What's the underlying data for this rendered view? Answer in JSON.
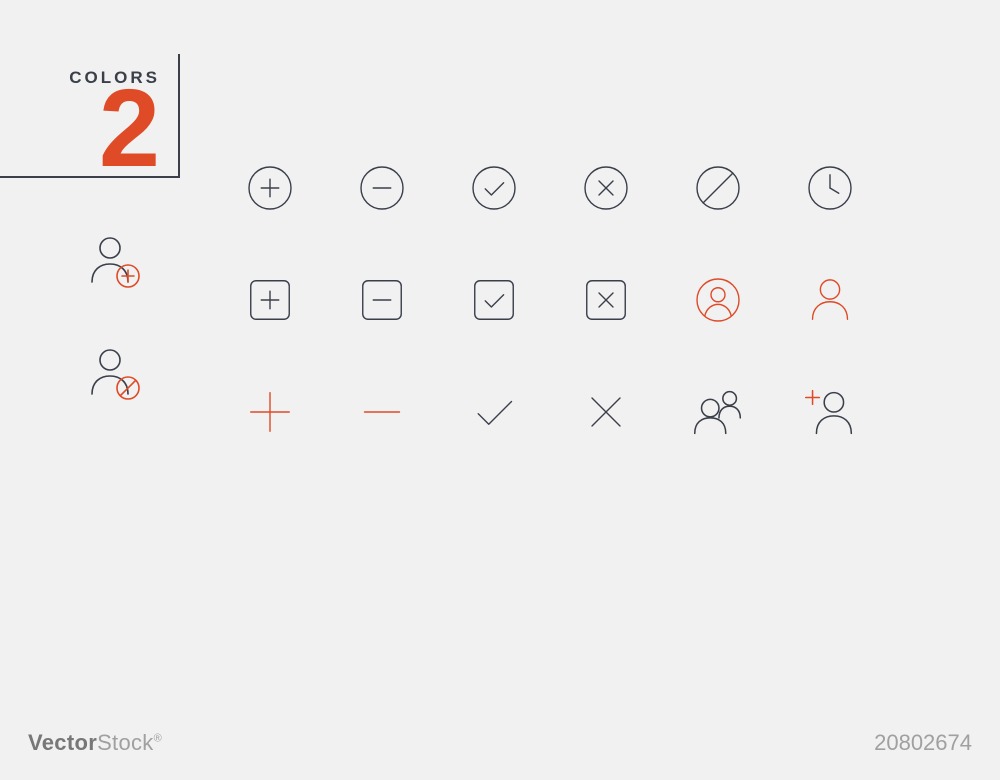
{
  "badge": {
    "label": "COLORS",
    "count": "2"
  },
  "colors": {
    "dark": "#3a3f4a",
    "accent": "#df4a27"
  },
  "icons": {
    "row1": [
      {
        "name": "circle-plus",
        "color": "dark"
      },
      {
        "name": "circle-minus",
        "color": "dark"
      },
      {
        "name": "circle-check",
        "color": "dark"
      },
      {
        "name": "circle-x",
        "color": "dark"
      },
      {
        "name": "circle-slash",
        "color": "dark"
      },
      {
        "name": "clock",
        "color": "dark"
      }
    ],
    "row2": [
      {
        "name": "square-plus",
        "color": "dark"
      },
      {
        "name": "square-minus",
        "color": "dark"
      },
      {
        "name": "square-check",
        "color": "dark"
      },
      {
        "name": "square-x",
        "color": "dark"
      },
      {
        "name": "user-circle",
        "color": "accent"
      },
      {
        "name": "user",
        "color": "accent"
      }
    ],
    "row3": [
      {
        "name": "plus-plain",
        "color": "accent"
      },
      {
        "name": "minus-plain",
        "color": "accent"
      },
      {
        "name": "check-plain",
        "color": "dark"
      },
      {
        "name": "x-plain",
        "color": "dark"
      },
      {
        "name": "users-group",
        "color": "dark"
      },
      {
        "name": "user-add",
        "color": "dark"
      }
    ],
    "leftcol": [
      {
        "name": "user-plus-circle",
        "color": "dark",
        "sub": "accent"
      },
      {
        "name": "user-block",
        "color": "dark",
        "sub": "accent"
      }
    ]
  },
  "footer": {
    "brand_prefix": "Vector",
    "brand_suffix": "Stock",
    "stock_id": "20802674"
  }
}
